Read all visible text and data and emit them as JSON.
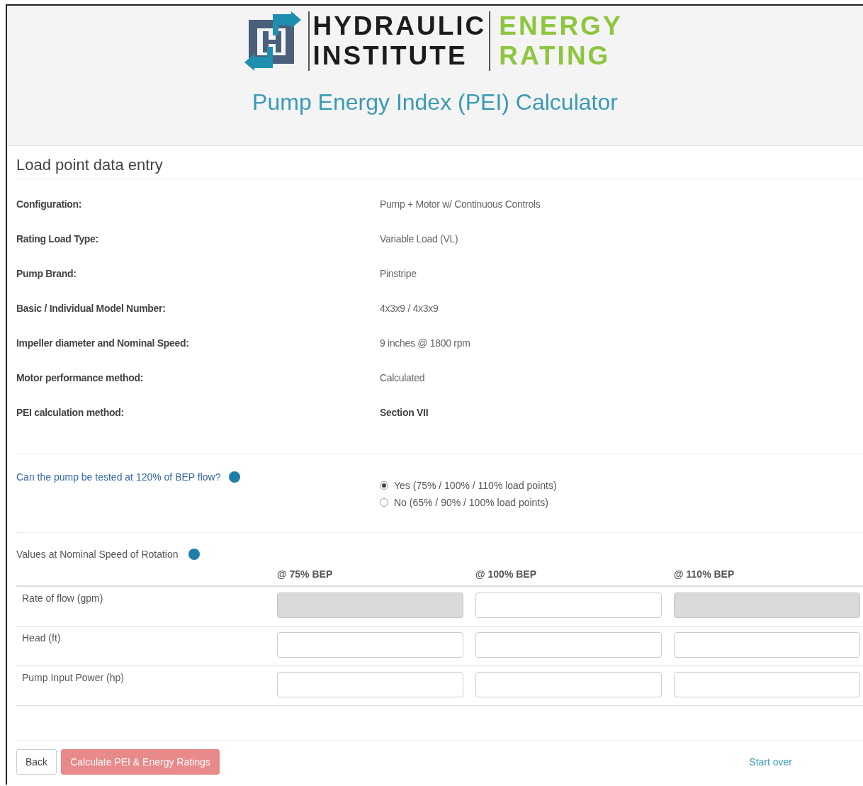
{
  "header": {
    "logo": {
      "line_1": "HYDRAULIC",
      "line_2": "INSTITUTE",
      "line_3": "ENERGY",
      "line_4": "RATING"
    },
    "title": "Pump Energy Index (PEI) Calculator"
  },
  "section_title": "Load point data entry",
  "details": [
    {
      "label": "Configuration:",
      "value": "Pump + Motor w/ Continuous Controls",
      "bold": false
    },
    {
      "label": "Rating Load Type:",
      "value": "Variable Load (VL)",
      "bold": false
    },
    {
      "label": "Pump Brand:",
      "value": "Pinstripe",
      "bold": false
    },
    {
      "label": "Basic / Individual Model Number:",
      "value": "4x3x9 / 4x3x9",
      "bold": false
    },
    {
      "label": "Impeller diameter and Nominal Speed:",
      "value": "9 inches @ 1800 rpm",
      "bold": false
    },
    {
      "label": "Motor performance method:",
      "value": "Calculated",
      "bold": false
    },
    {
      "label": "PEI calculation method:",
      "value": "Section VII",
      "bold": true
    }
  ],
  "question": {
    "text": "Can the pump be tested at 120% of BEP flow?",
    "options": [
      {
        "label": "Yes (75% / 100% / 110% load points)",
        "selected": true
      },
      {
        "label": "No (65% / 90% / 100% load points)",
        "selected": false
      }
    ]
  },
  "values_table": {
    "title": "Values at Nominal Speed of Rotation",
    "columns": [
      "@ 75% BEP",
      "@ 100% BEP",
      "@ 110% BEP"
    ],
    "rows": [
      {
        "label": "Rate of flow (gpm)",
        "fields": [
          {
            "disabled": true
          },
          {
            "disabled": false
          },
          {
            "disabled": true
          }
        ]
      },
      {
        "label": "Head (ft)",
        "fields": [
          {
            "disabled": false
          },
          {
            "disabled": false
          },
          {
            "disabled": false
          }
        ]
      },
      {
        "label": "Pump Input Power (hp)",
        "fields": [
          {
            "disabled": false
          },
          {
            "disabled": false
          },
          {
            "disabled": false
          }
        ]
      }
    ]
  },
  "buttons": {
    "back": "Back",
    "calculate": "Calculate PEI & Energy Ratings",
    "start_over": "Start over"
  }
}
